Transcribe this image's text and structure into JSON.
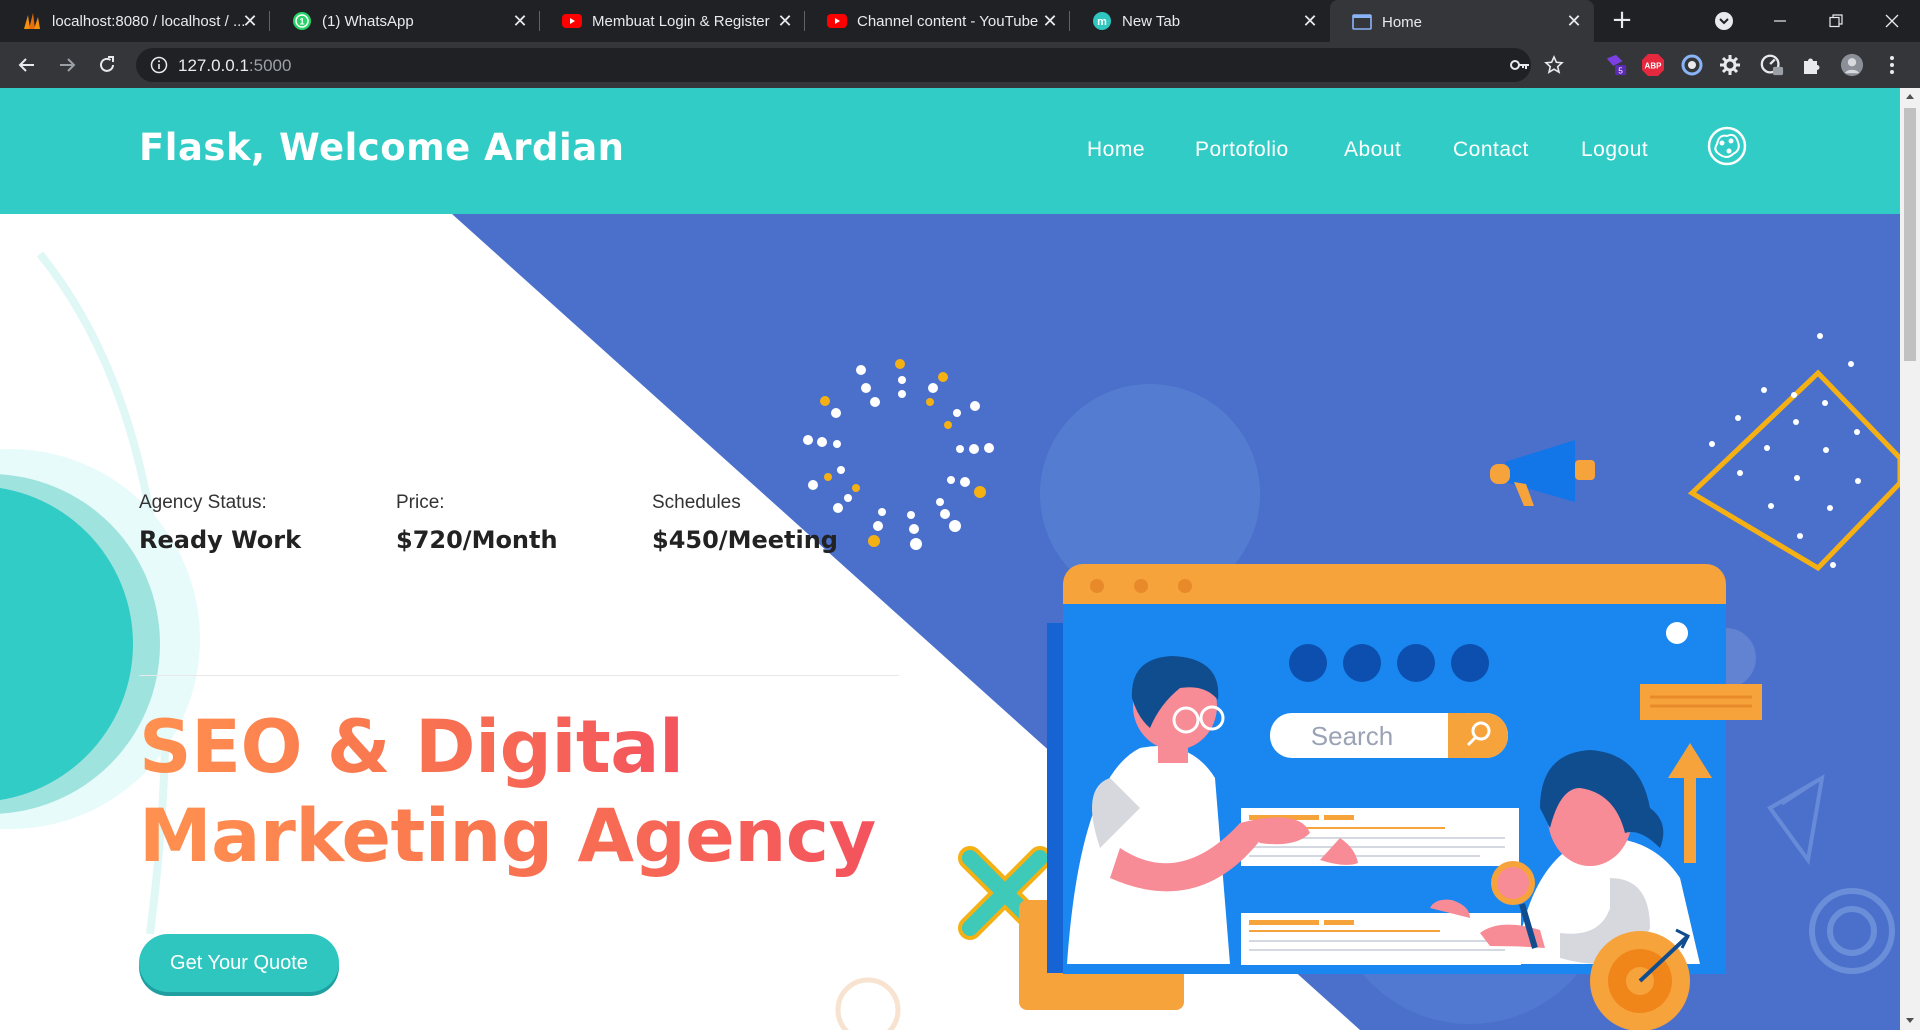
{
  "browser": {
    "tabs": [
      {
        "title": "localhost:8080 / localhost / ...",
        "icon": "phpmyadmin-icon"
      },
      {
        "title": "(1) WhatsApp",
        "icon": "whatsapp-icon"
      },
      {
        "title": "Membuat Login & Register",
        "icon": "youtube-icon"
      },
      {
        "title": "Channel content - YouTube",
        "icon": "youtube-icon"
      },
      {
        "title": "New Tab",
        "icon": "new-tab-m-icon"
      },
      {
        "title": "Home",
        "icon": "page-icon",
        "active": true
      }
    ],
    "new_tab_label": "+",
    "url_host": "127.0.0.1",
    "url_port": ":5000",
    "extensions": [
      "password-key-icon",
      "bookmark-star-icon",
      "extension-badge-icon",
      "adblock-icon",
      "circle-extension-icon",
      "gear-extension-icon",
      "speedometer-icon",
      "puzzle-icon",
      "profile-avatar-icon",
      "kebab-menu-icon"
    ],
    "ext_badge": "5",
    "abp_label": "ABP"
  },
  "site": {
    "brand": "Flask, Welcome Ardian",
    "nav": [
      "Home",
      "Portofolio",
      "About",
      "Contact",
      "Logout"
    ],
    "colors": {
      "header": "#32ccc6",
      "accent_orange": "#ff9150",
      "accent_red": "#f4535e",
      "hero_blue": "#4b70cc"
    }
  },
  "hero": {
    "stats": [
      {
        "label": "Agency Status:",
        "value": "Ready Work"
      },
      {
        "label": "Price:",
        "value": "$720/Month"
      },
      {
        "label": "Schedules",
        "value": "$450/Meeting"
      }
    ],
    "headline_line1": "SEO & Digital",
    "headline_line2": "Marketing Agency",
    "cta": "Get Your Quote",
    "illustration_search": "Search"
  }
}
